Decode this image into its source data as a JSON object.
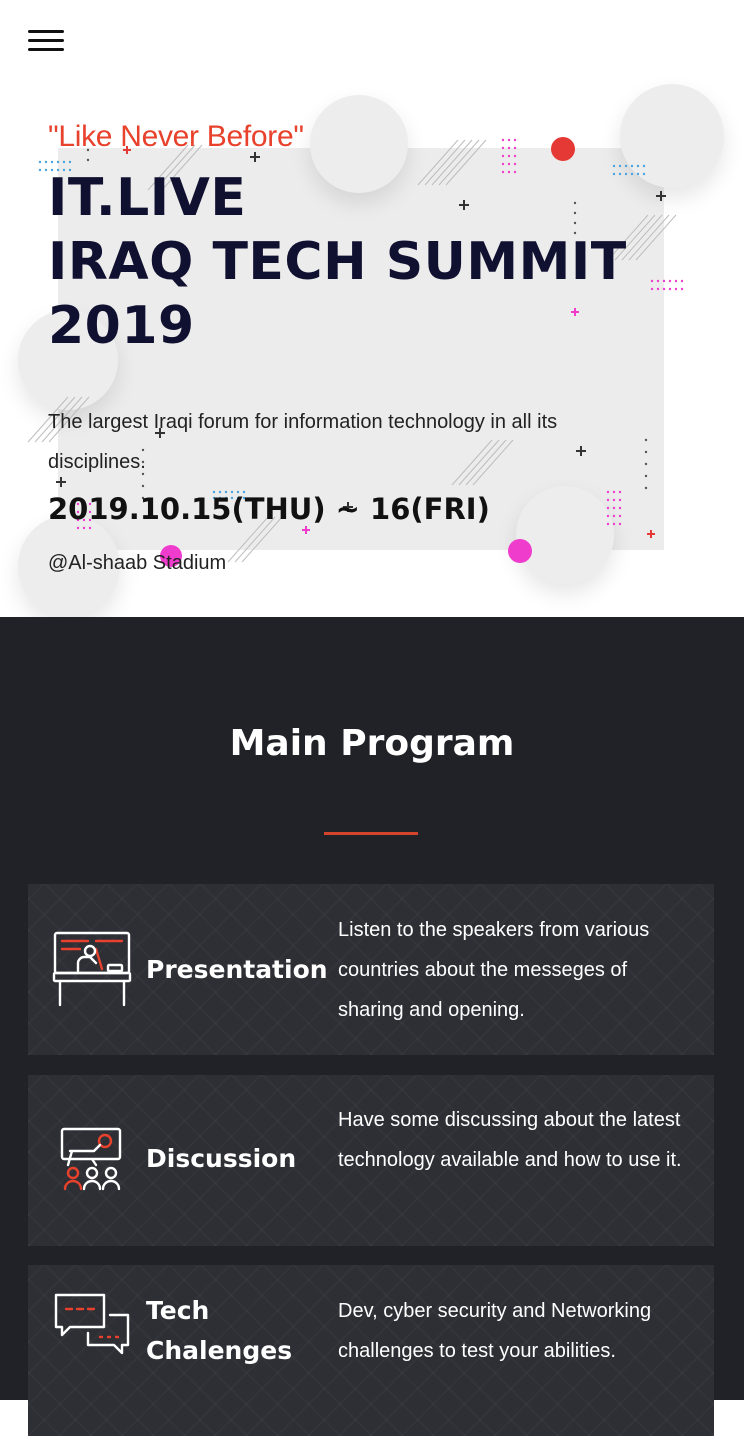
{
  "header": {
    "menu_icon": "hamburger-menu-icon"
  },
  "hero": {
    "tagline": "\"Like Never Before\"",
    "title_lines": [
      "IT.LIVE",
      "IRAQ TECH SUMMIT",
      "2019"
    ],
    "description": "The largest Iraqi forum for information technology in all its disciplines.",
    "date": "2019.10.15(THU) ~ 16(FRI)",
    "venue": "@Al-shaab Stadium"
  },
  "program": {
    "title": "Main Program",
    "items": [
      {
        "name": "Presentation",
        "icon": "presentation-icon",
        "description": "Listen to the speakers from various countries about the messeges of sharing and opening."
      },
      {
        "name": "Discussion",
        "icon": "discussion-icon",
        "description": "Have some discussing about the latest technology available and how to use it."
      },
      {
        "name": "Tech Chalenges",
        "icon": "chat-bubbles-icon",
        "description": "Dev, cyber security and Networking challenges to test your abilities."
      }
    ]
  },
  "colors": {
    "accent": "#e8412c",
    "title": "#101030",
    "dark_bg": "#212227",
    "card_bg": "#2e2f35",
    "pink": "#f03ccd",
    "red_dot": "#e53935"
  }
}
